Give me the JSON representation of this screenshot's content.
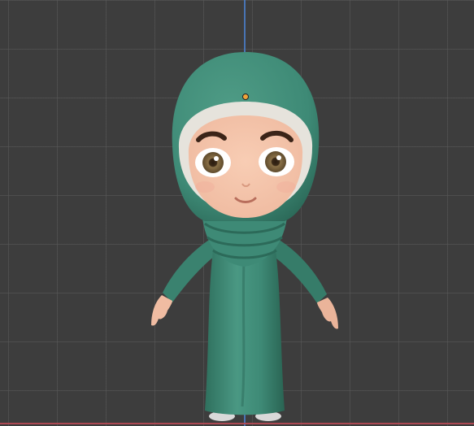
{
  "viewport": {
    "mode": "3d-viewport",
    "background_color": "#3d3d3d",
    "grid_color": "#5a5a5a",
    "axis_colors": {
      "z_axis": "#4a7ec9",
      "x_axis": "#b84a55"
    },
    "origin_marker_color": "#f0a43a"
  },
  "model": {
    "subject": "cartoon-girl-in-hijab",
    "colors": {
      "garment": "#3e8a76",
      "garment_shadow": "#2c6a59",
      "skin": "#f2c2a8",
      "under_scarf": "#e6e3dc",
      "eyebrows": "#3b2418",
      "iris": "#6f5a37"
    }
  }
}
